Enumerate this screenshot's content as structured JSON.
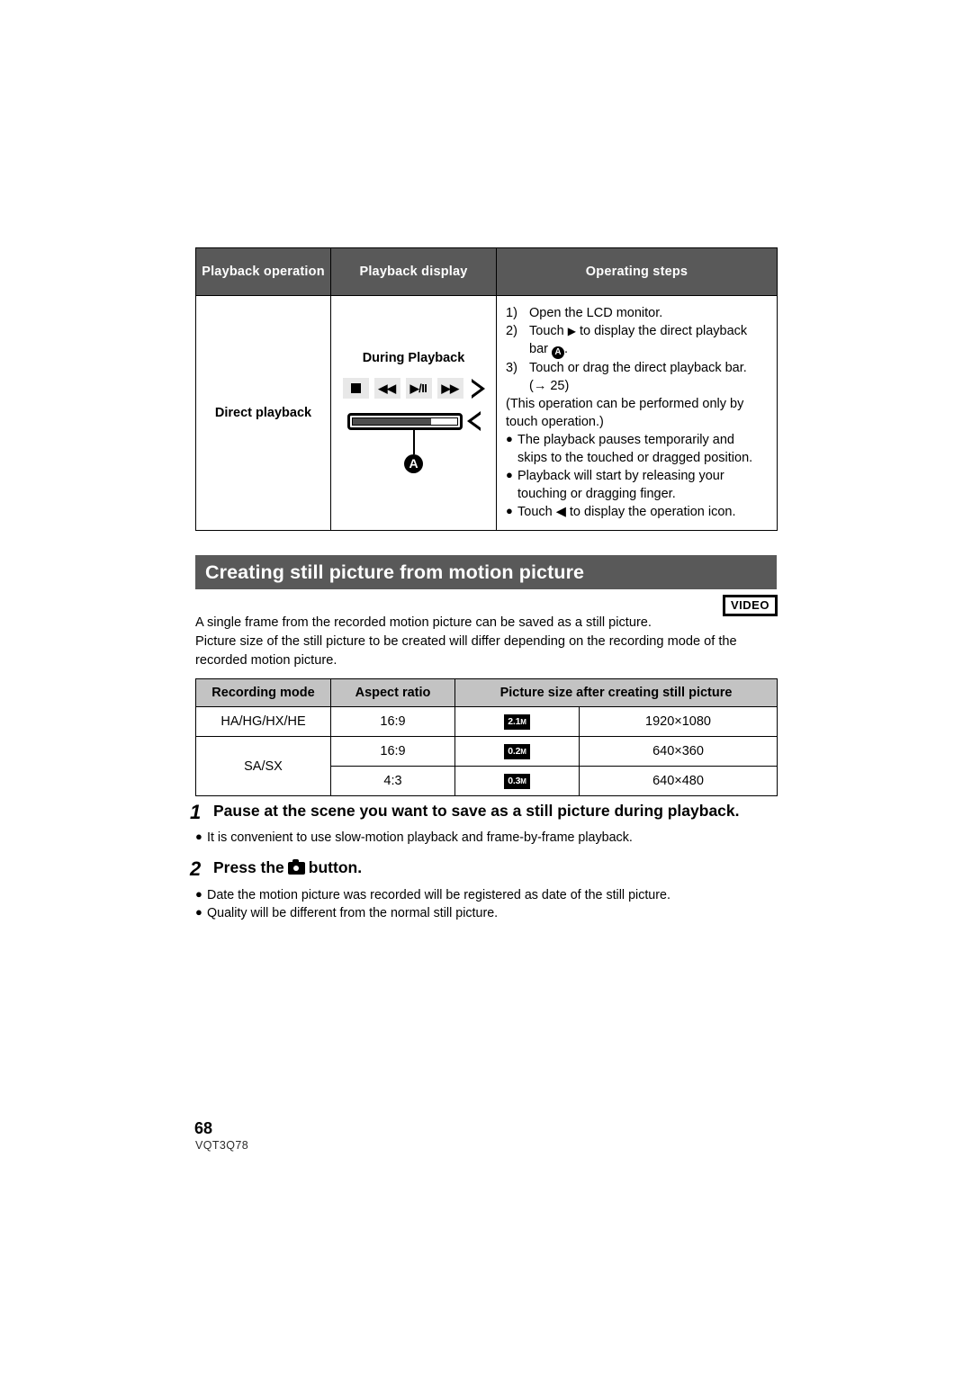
{
  "playback_table": {
    "headers": [
      "Playback operation",
      "Playback display",
      "Operating steps"
    ],
    "row": {
      "operation": "Direct playback",
      "display": {
        "title": "During Playback",
        "keys": [
          "stop",
          "rewind",
          "play-pause",
          "fast-forward"
        ],
        "play_pause_label": "▶/II",
        "rewind_label": "◀◀",
        "forward_label": "▶▶",
        "bar_fill_percent": 75,
        "callout_label": "A"
      },
      "steps": [
        {
          "num": "1)",
          "text": "Open the LCD monitor."
        },
        {
          "num": "2)",
          "text_a": "Touch ",
          "glyph": "right-triangle",
          "text_b": " to display the direct playback bar ",
          "callout": "A",
          "text_c": "."
        },
        {
          "num": "3)",
          "text": "Touch or drag the direct playback bar. (→ 25)"
        }
      ],
      "note": "(This operation can be performed only by touch operation.)",
      "bullets": [
        "The playback pauses temporarily and skips to the touched or dragged position.",
        "Playback will start by releasing your touching or dragging finger.",
        "Touch ◀ to display the operation icon."
      ]
    }
  },
  "section": {
    "heading": "Creating still picture from motion picture",
    "badge": "VIDEO",
    "intro_line_1": "A single frame from the recorded motion picture can be saved as a still picture.",
    "intro_line_2": "Picture size of the still picture to be created will differ depending on the recording mode of the recorded motion picture."
  },
  "recmode_table": {
    "headers": [
      "Recording mode",
      "Aspect ratio",
      "Picture size after creating still picture"
    ],
    "rows": [
      {
        "mode": "HA/HG/HX/HE",
        "aspect": "16:9",
        "badge_value": "2.1",
        "badge_unit": "M",
        "size": "1920×1080"
      },
      {
        "mode": "SA/SX",
        "aspect": "16:9",
        "badge_value": "0.2",
        "badge_unit": "M",
        "size": "640×360"
      },
      {
        "mode": "",
        "aspect": "4:3",
        "badge_value": "0.3",
        "badge_unit": "M",
        "size": "640×480"
      }
    ]
  },
  "procedure": {
    "steps": [
      {
        "num": "1",
        "text": "Pause at the scene you want to save as a still picture during playback.",
        "bullets": [
          "It is convenient to use slow-motion playback and frame-by-frame playback."
        ]
      },
      {
        "num": "2",
        "text_before": "Press the",
        "icon": "camera-button-icon",
        "text_after": "button.",
        "bullets": [
          "Date the motion picture was recorded will be registered as date of the still picture.",
          "Quality will be different from the normal still picture."
        ]
      }
    ]
  },
  "footer": {
    "page_number": "68",
    "doc_code": "VQT3Q78"
  },
  "colors": {
    "header_dark": "#595959",
    "header_light": "#c3c3c3",
    "key_bg": "#e8e8e8",
    "bar_fill": "#4d4d4d"
  }
}
